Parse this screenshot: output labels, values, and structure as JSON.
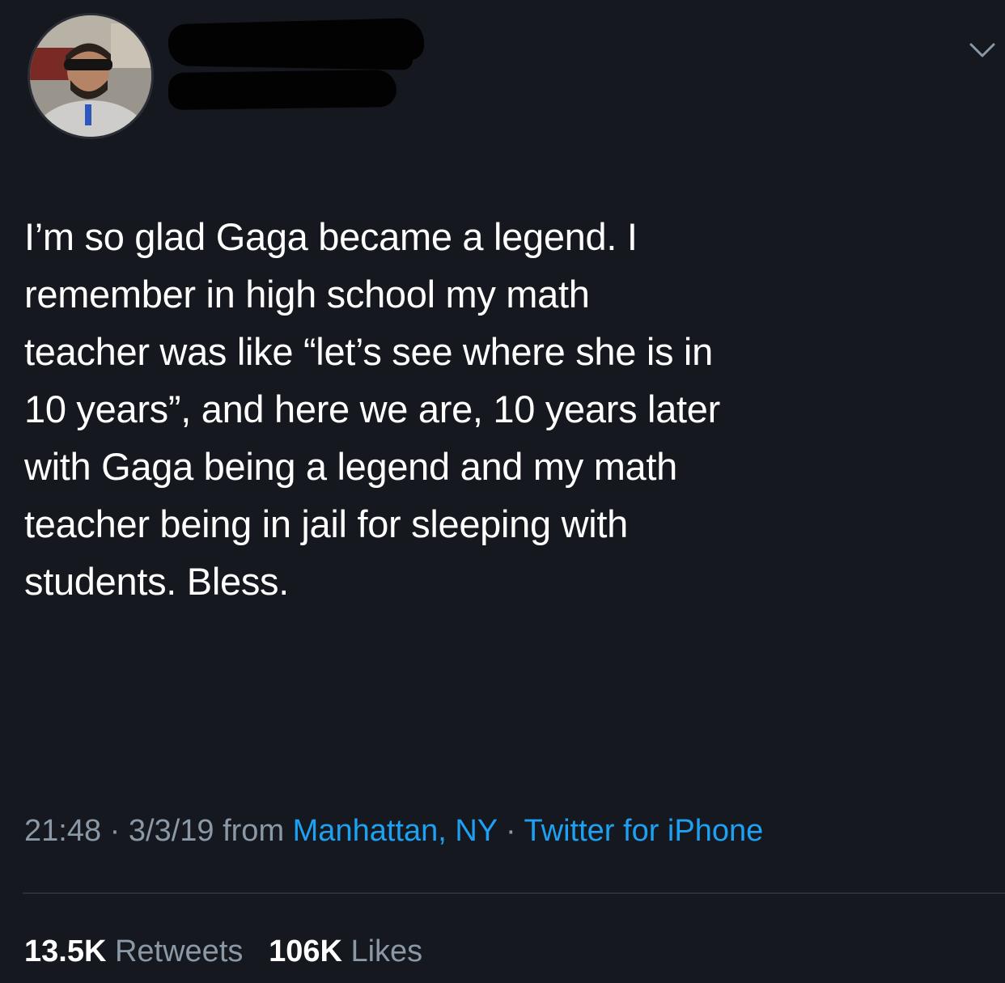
{
  "tweet": {
    "lines": [
      "I’m so glad Gaga became a legend. I",
      "remember in high school my math",
      "teacher was like “let’s see where she is in",
      "10 years”, and here we are, 10 years later",
      "with Gaga being a legend and my math",
      "teacher being in jail for sleeping with",
      "students. Bless."
    ],
    "time": "21:48",
    "date": "3/3/19",
    "from_label": "from",
    "location": "Manhattan, NY",
    "separator": "·",
    "source": "Twitter for iPhone"
  },
  "stats": {
    "retweets_count": "13.5K",
    "retweets_label": "Retweets",
    "likes_count": "106K",
    "likes_label": "Likes"
  },
  "icons": {
    "chevron": "chevron-down-icon"
  },
  "colors": {
    "background": "#15181f",
    "text": "#ffffff",
    "secondary": "#8b98a5",
    "link": "#1da1f2",
    "divider": "#2a2f38"
  }
}
